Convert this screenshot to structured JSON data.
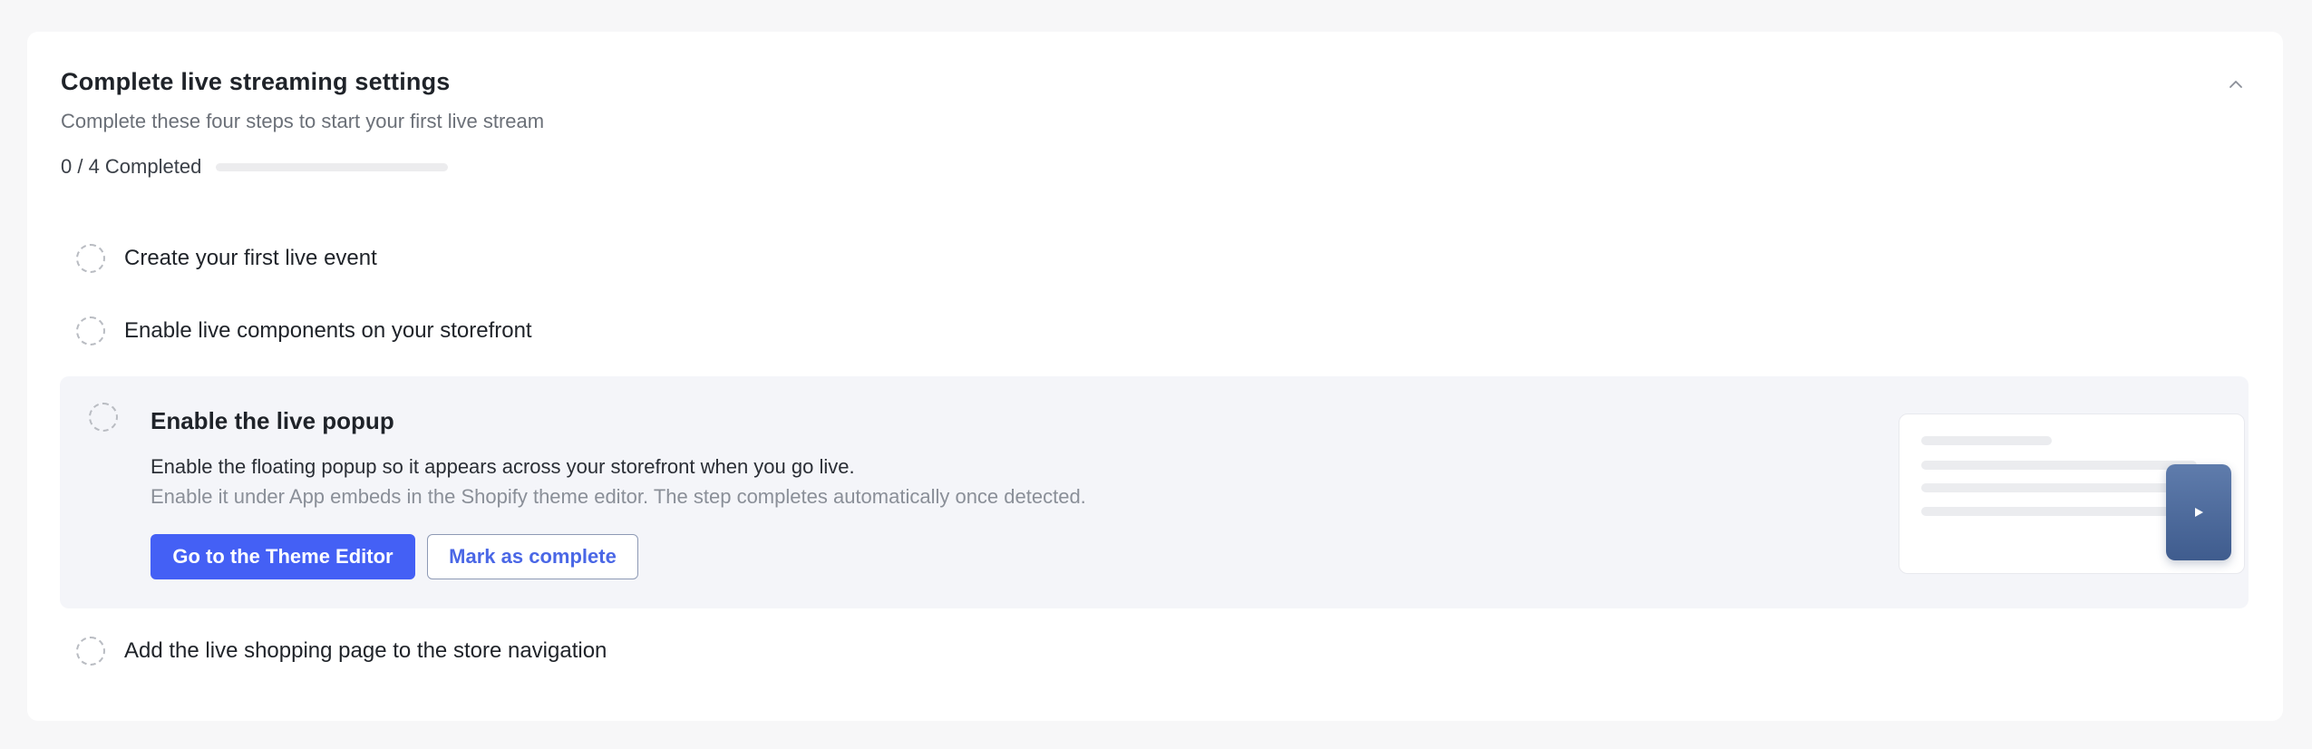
{
  "header": {
    "title": "Complete live streaming settings",
    "subtitle": "Complete these four steps to start your first live stream",
    "collapse_icon": "chevron-up-icon"
  },
  "progress": {
    "label": "0 / 4 Completed",
    "completed": 0,
    "total": 4,
    "accent_color": "#4460f5"
  },
  "steps": [
    {
      "title": "Create your first live event",
      "completed": false
    },
    {
      "title": "Enable live components on your storefront",
      "completed": false
    },
    {
      "title": "Enable the live popup",
      "completed": false,
      "expanded": true,
      "description": "Enable the floating popup so it appears across your storefront when you go live.",
      "hint": "Enable it under App embeds in the Shopify theme editor. The step completes automatically once detected.",
      "primary_button": "Go to the Theme Editor",
      "secondary_button": "Mark as complete",
      "preview_icon": "play-icon"
    },
    {
      "title": "Add the live shopping page to the store navigation",
      "completed": false
    }
  ],
  "colors": {
    "primary": "#4460f5",
    "widget": "#4a6798"
  }
}
